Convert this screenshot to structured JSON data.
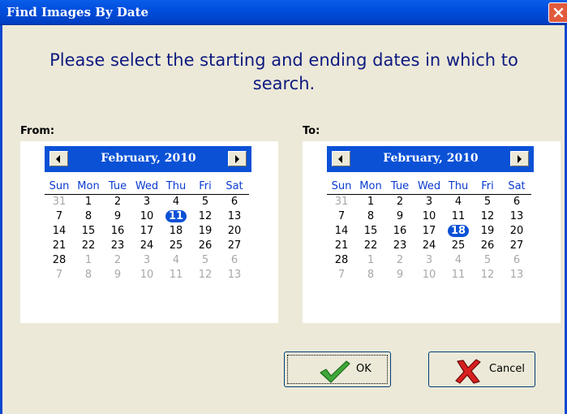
{
  "window": {
    "title": "Find Images By Date"
  },
  "prompt": "Please select the starting and ending dates in which to search.",
  "days_of_week": [
    "Sun",
    "Mon",
    "Tue",
    "Wed",
    "Thu",
    "Fri",
    "Sat"
  ],
  "from": {
    "label": "From:",
    "month_title": "February, 2010",
    "selected_day": "11",
    "weeks": [
      [
        {
          "d": "31",
          "o": true
        },
        {
          "d": "1"
        },
        {
          "d": "2"
        },
        {
          "d": "3"
        },
        {
          "d": "4"
        },
        {
          "d": "5"
        },
        {
          "d": "6"
        }
      ],
      [
        {
          "d": "7"
        },
        {
          "d": "8"
        },
        {
          "d": "9"
        },
        {
          "d": "10"
        },
        {
          "d": "11",
          "s": true
        },
        {
          "d": "12"
        },
        {
          "d": "13"
        }
      ],
      [
        {
          "d": "14"
        },
        {
          "d": "15"
        },
        {
          "d": "16"
        },
        {
          "d": "17"
        },
        {
          "d": "18"
        },
        {
          "d": "19"
        },
        {
          "d": "20"
        }
      ],
      [
        {
          "d": "21"
        },
        {
          "d": "22"
        },
        {
          "d": "23"
        },
        {
          "d": "24"
        },
        {
          "d": "25"
        },
        {
          "d": "26"
        },
        {
          "d": "27"
        }
      ],
      [
        {
          "d": "28"
        },
        {
          "d": "1",
          "o": true
        },
        {
          "d": "2",
          "o": true
        },
        {
          "d": "3",
          "o": true
        },
        {
          "d": "4",
          "o": true
        },
        {
          "d": "5",
          "o": true
        },
        {
          "d": "6",
          "o": true
        }
      ],
      [
        {
          "d": "7",
          "o": true
        },
        {
          "d": "8",
          "o": true
        },
        {
          "d": "9",
          "o": true
        },
        {
          "d": "10",
          "o": true
        },
        {
          "d": "11",
          "o": true
        },
        {
          "d": "12",
          "o": true
        },
        {
          "d": "13",
          "o": true
        }
      ]
    ]
  },
  "to": {
    "label": "To:",
    "month_title": "February, 2010",
    "selected_day": "18",
    "weeks": [
      [
        {
          "d": "31",
          "o": true
        },
        {
          "d": "1"
        },
        {
          "d": "2"
        },
        {
          "d": "3"
        },
        {
          "d": "4"
        },
        {
          "d": "5"
        },
        {
          "d": "6"
        }
      ],
      [
        {
          "d": "7"
        },
        {
          "d": "8"
        },
        {
          "d": "9"
        },
        {
          "d": "10"
        },
        {
          "d": "11"
        },
        {
          "d": "12"
        },
        {
          "d": "13"
        }
      ],
      [
        {
          "d": "14"
        },
        {
          "d": "15"
        },
        {
          "d": "16"
        },
        {
          "d": "17"
        },
        {
          "d": "18",
          "s": true
        },
        {
          "d": "19"
        },
        {
          "d": "20"
        }
      ],
      [
        {
          "d": "21"
        },
        {
          "d": "22"
        },
        {
          "d": "23"
        },
        {
          "d": "24"
        },
        {
          "d": "25"
        },
        {
          "d": "26"
        },
        {
          "d": "27"
        }
      ],
      [
        {
          "d": "28"
        },
        {
          "d": "1",
          "o": true
        },
        {
          "d": "2",
          "o": true
        },
        {
          "d": "3",
          "o": true
        },
        {
          "d": "4",
          "o": true
        },
        {
          "d": "5",
          "o": true
        },
        {
          "d": "6",
          "o": true
        }
      ],
      [
        {
          "d": "7",
          "o": true
        },
        {
          "d": "8",
          "o": true
        },
        {
          "d": "9",
          "o": true
        },
        {
          "d": "10",
          "o": true
        },
        {
          "d": "11",
          "o": true
        },
        {
          "d": "12",
          "o": true
        },
        {
          "d": "13",
          "o": true
        }
      ]
    ]
  },
  "buttons": {
    "ok": "OK",
    "cancel": "Cancel"
  },
  "colors": {
    "title_bar": "#0050df",
    "accent": "#0a51d6",
    "prompt_text": "#0e1a80",
    "dialog_bg": "#ece9d8",
    "other_month_day": "#a8a8a8"
  },
  "icons": {
    "close": "close-x-icon",
    "prev": "left-arrow-icon",
    "next": "right-arrow-icon",
    "ok": "green-check-icon",
    "cancel": "red-x-icon"
  }
}
